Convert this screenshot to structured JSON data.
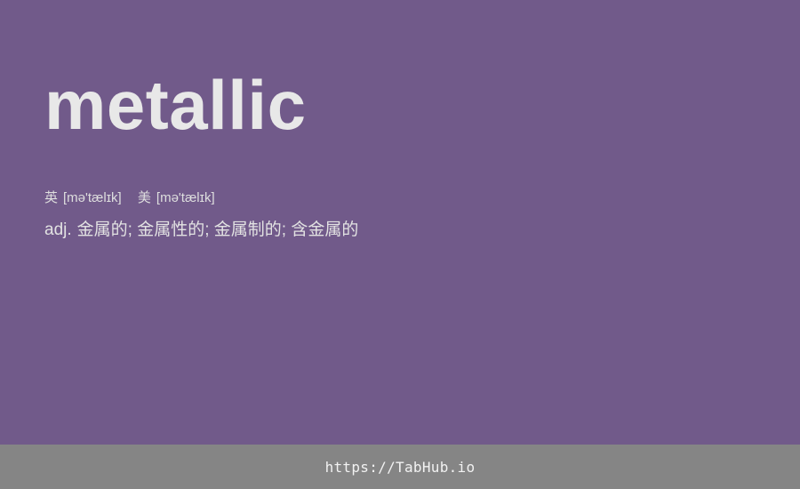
{
  "entry": {
    "word": "metallic",
    "phonetics": {
      "uk_label": "英",
      "uk": "[mə'tælɪk]",
      "us_label": "美",
      "us": "[mə'tælɪk]"
    },
    "definition": {
      "pos": "adj.",
      "text": "金属的; 金属性的; 金属制的; 含金属的"
    }
  },
  "footer": {
    "link": "https://TabHub.io"
  },
  "colors": {
    "background": "#715a8a",
    "footer_background": "#858585",
    "text": "#e6e6e6"
  }
}
